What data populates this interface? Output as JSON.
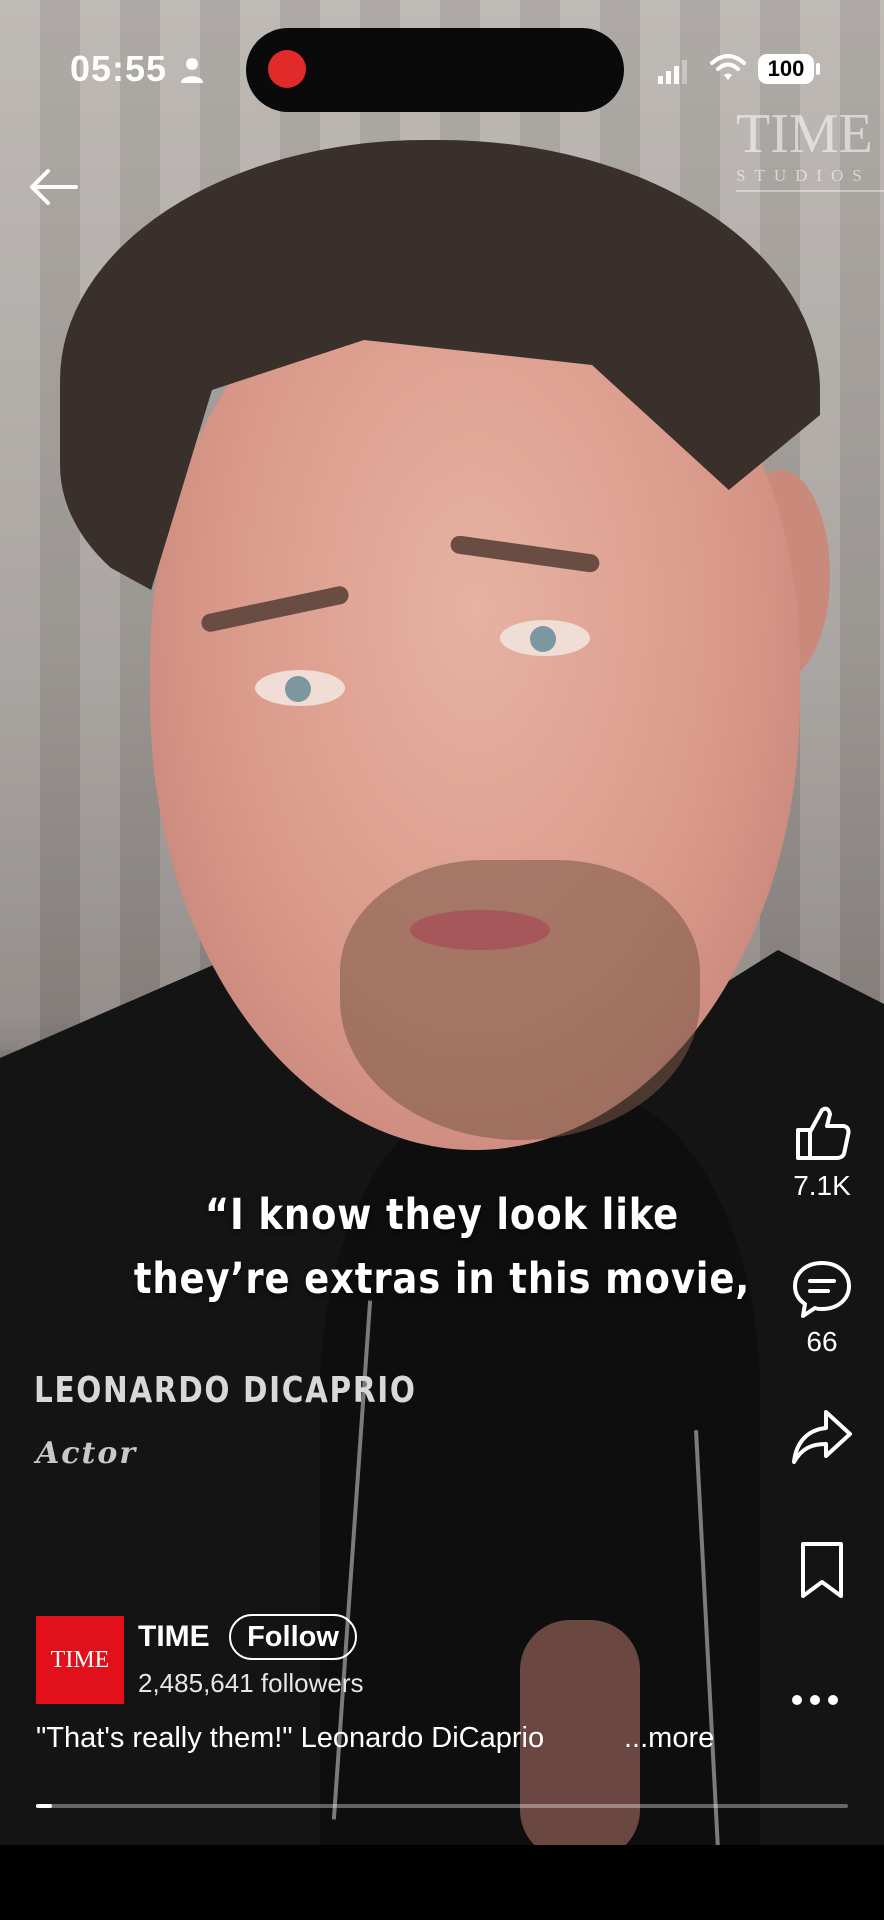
{
  "status_bar": {
    "time": "05:55",
    "battery": "100"
  },
  "watermark": {
    "brand": "TIME",
    "sub": "STUDIOS"
  },
  "caption": {
    "line1": "“I know they look like",
    "line2": "they’re extras in this movie,"
  },
  "lower_third": {
    "name": "LEONARDO DICAPRIO",
    "role": "Actor"
  },
  "actions": {
    "likes": "7.1K",
    "comments": "66"
  },
  "channel": {
    "logo_text": "TIME",
    "name": "TIME",
    "follow_label": "Follow",
    "followers": "2,485,641 followers",
    "logo_color": "#e2101b"
  },
  "post": {
    "description": "\"That's really them!\" Leonardo DiCaprio",
    "more_label": "...more"
  },
  "progress": {
    "fraction": 0.02
  },
  "icons": [
    "person-icon",
    "signal-icon",
    "wifi-icon",
    "back-arrow-icon",
    "like-icon",
    "comment-icon",
    "share-icon",
    "bookmark-icon",
    "more-icon"
  ]
}
